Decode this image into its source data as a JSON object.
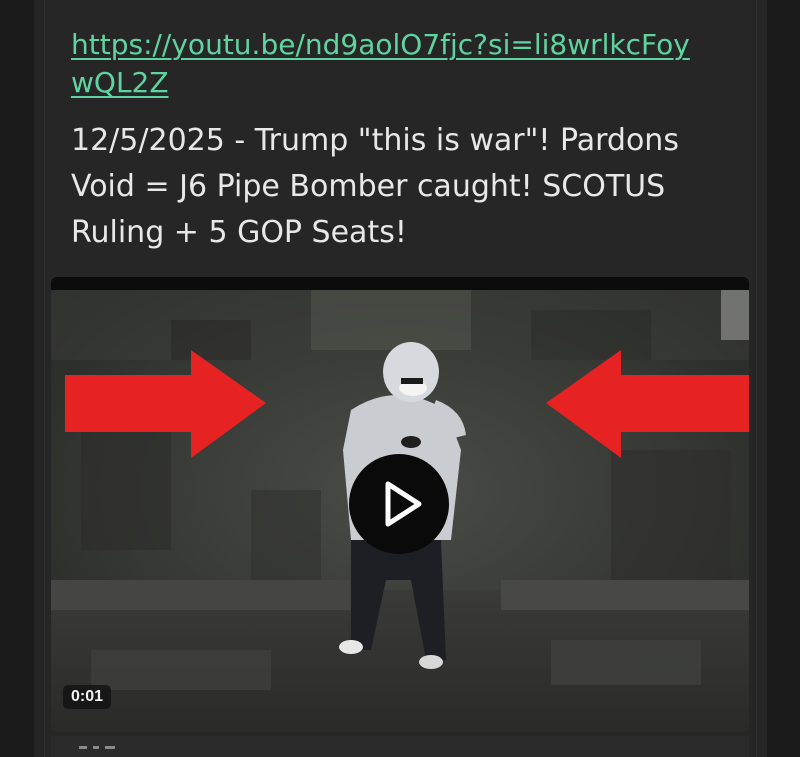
{
  "post": {
    "link_text": "https://youtu.be/nd9aolO7fjc?si=li8wrlkcFoywQL2Z",
    "body_text": "12/5/2025 - Trump \"this is war\"! Pardons Void = J6 Pipe Bomber caught! SCOTUS Ruling + 5 GOP Seats!"
  },
  "video": {
    "duration": "0:01",
    "play_icon": "play-icon",
    "arrow_color": "#e62222"
  },
  "colors": {
    "background": "#1b1b1b",
    "card": "#262626",
    "link": "#5fd3a0",
    "text": "#e8e8e8"
  }
}
